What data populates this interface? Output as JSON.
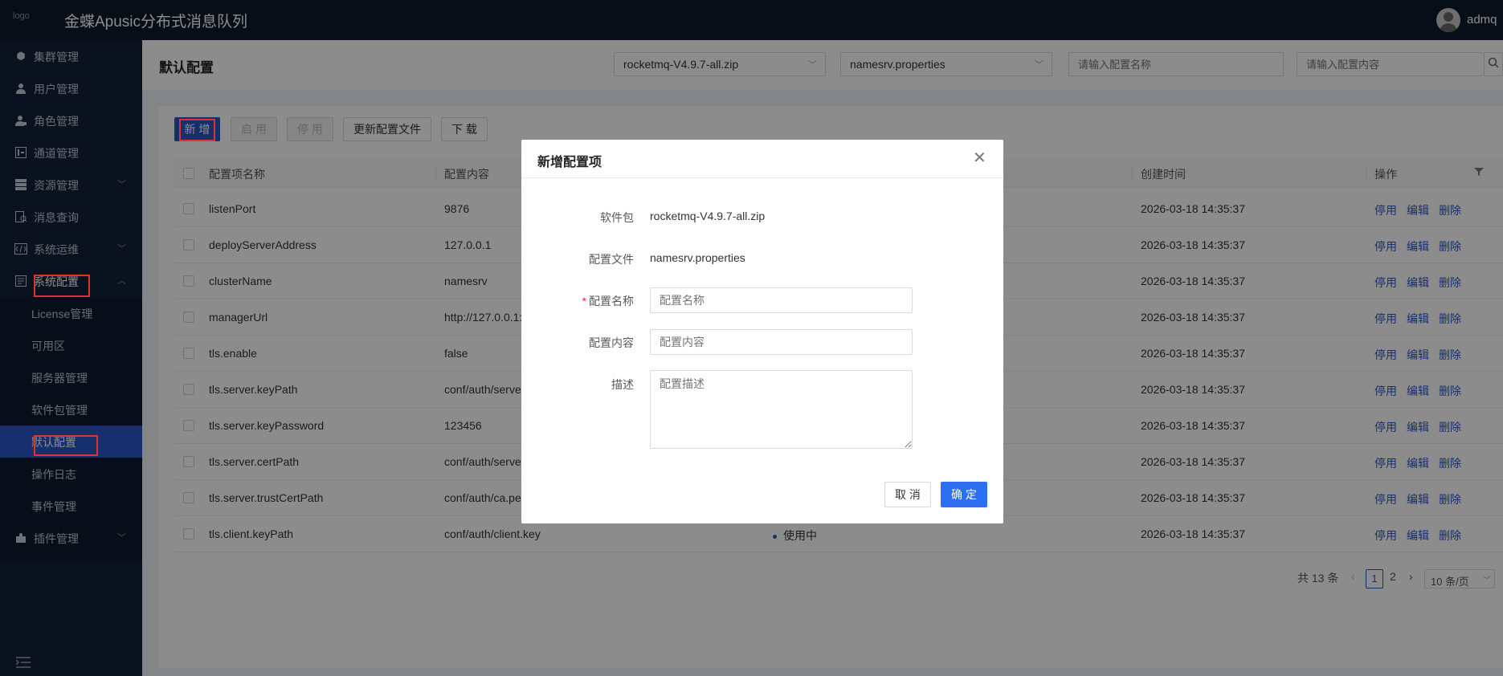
{
  "header": {
    "logo_alt": "logo",
    "app_title": "金蝶Apusic分布式消息队列",
    "username": "admq"
  },
  "sidebar": {
    "items": [
      {
        "label": "集群管理",
        "icon": "cluster-icon"
      },
      {
        "label": "用户管理",
        "icon": "user-icon"
      },
      {
        "label": "角色管理",
        "icon": "role-icon"
      },
      {
        "label": "通道管理",
        "icon": "channel-icon"
      },
      {
        "label": "资源管理",
        "icon": "resource-icon"
      },
      {
        "label": "消息查询",
        "icon": "message-query-icon"
      },
      {
        "label": "系统运维",
        "icon": "ops-icon"
      },
      {
        "label": "系统配置",
        "icon": "config-icon"
      },
      {
        "label": "插件管理",
        "icon": "plugin-icon"
      }
    ],
    "sub_items": [
      "License管理",
      "可用区",
      "服务器管理",
      "软件包管理",
      "默认配置",
      "操作日志",
      "事件管理"
    ]
  },
  "page": {
    "title": "默认配置",
    "package_select": "rocketmq-V4.9.7-all.zip",
    "file_select": "namesrv.properties",
    "name_search_placeholder": "请输入配置名称",
    "content_search_placeholder": "请输入配置内容"
  },
  "toolbar": {
    "add": "新 增",
    "enable": "启 用",
    "disable": "停 用",
    "update_file": "更新配置文件",
    "download": "下 载"
  },
  "table": {
    "columns": {
      "name": "配置项名称",
      "content": "配置内容",
      "created": "创建时间",
      "actions": "操作"
    },
    "actions": {
      "stop": "停用",
      "edit": "编辑",
      "delete": "删除"
    },
    "status_in_use": "使用中",
    "rows": [
      {
        "name": "listenPort",
        "content": "9876",
        "created": "2026-03-18 14:35:37"
      },
      {
        "name": "deployServerAddress",
        "content": "127.0.0.1",
        "created": "2026-03-18 14:35:37"
      },
      {
        "name": "clusterName",
        "content": "namesrv",
        "created": "2026-03-18 14:35:37"
      },
      {
        "name": "managerUrl",
        "content": "http://127.0.0.1:",
        "created": "2026-03-18 14:35:37"
      },
      {
        "name": "tls.enable",
        "content": "false",
        "created": "2026-03-18 14:35:37"
      },
      {
        "name": "tls.server.keyPath",
        "content": "conf/auth/serve",
        "created": "2026-03-18 14:35:37"
      },
      {
        "name": "tls.server.keyPassword",
        "content": "123456",
        "created": "2026-03-18 14:35:37"
      },
      {
        "name": "tls.server.certPath",
        "content": "conf/auth/serve",
        "created": "2026-03-18 14:35:37"
      },
      {
        "name": "tls.server.trustCertPath",
        "content": "conf/auth/ca.pe",
        "created": "2026-03-18 14:35:37"
      },
      {
        "name": "tls.client.keyPath",
        "content": "conf/auth/client.key",
        "created": "2026-03-18 14:35:37"
      }
    ]
  },
  "pagination": {
    "total": "共 13 条",
    "prev": "‹",
    "current": "1",
    "page2": "2",
    "next": "›",
    "page_size": "10 条/页"
  },
  "modal": {
    "title": "新增配置项",
    "close": "✕",
    "package_label": "软件包",
    "package_value": "rocketmq-V4.9.7-all.zip",
    "file_label": "配置文件",
    "file_value": "namesrv.properties",
    "name_label": "配置名称",
    "name_placeholder": "配置名称",
    "content_label": "配置内容",
    "content_placeholder": "配置内容",
    "desc_label": "描述",
    "desc_placeholder": "配置描述",
    "cancel": "取 消",
    "ok": "确 定"
  }
}
